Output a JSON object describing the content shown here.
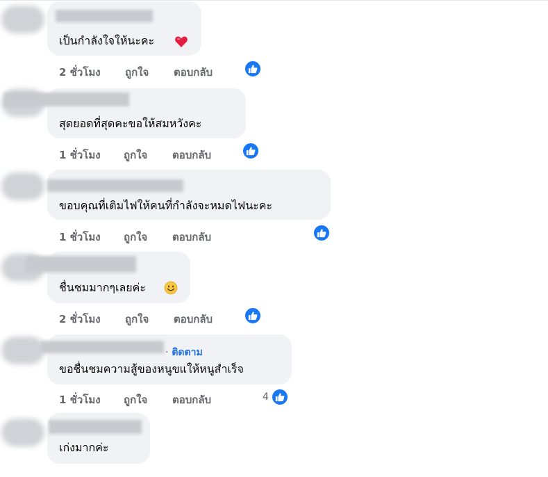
{
  "comments": [
    {
      "text": "เป็นกำลังใจให้นะคะ",
      "time": "2 ชั่วโมง",
      "like": "ถูกใจ",
      "reply": "ตอบกลับ",
      "emoji": "heart-emoji"
    },
    {
      "text": "สุดยอดที่สุดคะขอให้สมหวังคะ",
      "time": "1 ชั่วโมง",
      "like": "ถูกใจ",
      "reply": "ตอบกลับ"
    },
    {
      "text": "ขอบคุณที่เติมไฟให้คนที่กำลังจะหมดไฟนะคะ",
      "time": "1 ชั่วโมง",
      "like": "ถูกใจ",
      "reply": "ตอบกลับ"
    },
    {
      "text": "ชื่นชมมากๆเลยค่ะ",
      "time": "2 ชั่วโมง",
      "like": "ถูกใจ",
      "reply": "ตอบกลับ",
      "emoji": "smile-emoji"
    },
    {
      "text": "ขอชื่นชมความสู้ของหนูขแให้หนูสำเร็จ",
      "time": "1 ชั่วโมง",
      "like": "ถูกใจ",
      "reply": "ตอบกลับ",
      "follow": "ติดตาม",
      "separator": "·",
      "reaction_count": "4"
    },
    {
      "text": "เก่งมากค่ะ"
    }
  ],
  "colors": {
    "bubble": "#f0f2f5",
    "meta": "#65676b",
    "like_blue": "#1877f2",
    "follow": "#216fdb"
  }
}
